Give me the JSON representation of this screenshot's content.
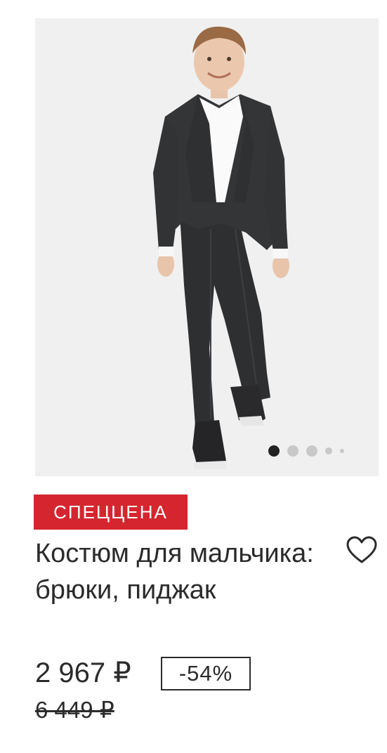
{
  "product": {
    "badge": "СПЕЦЦЕНА",
    "title": "Костюм для мальчика: брюки, пиджак",
    "price": "2 967 ₽",
    "discount": "-54%",
    "old_price": "6 449 ₽",
    "favorite_icon": "heart-outline-icon",
    "image_count": 5,
    "active_image_index": 0
  },
  "colors": {
    "badge_bg": "#d5262f",
    "text": "#2b2b2b",
    "image_bg": "#f0f0f0",
    "dot_active": "#222222",
    "dot_inactive": "#c8c8c8"
  }
}
